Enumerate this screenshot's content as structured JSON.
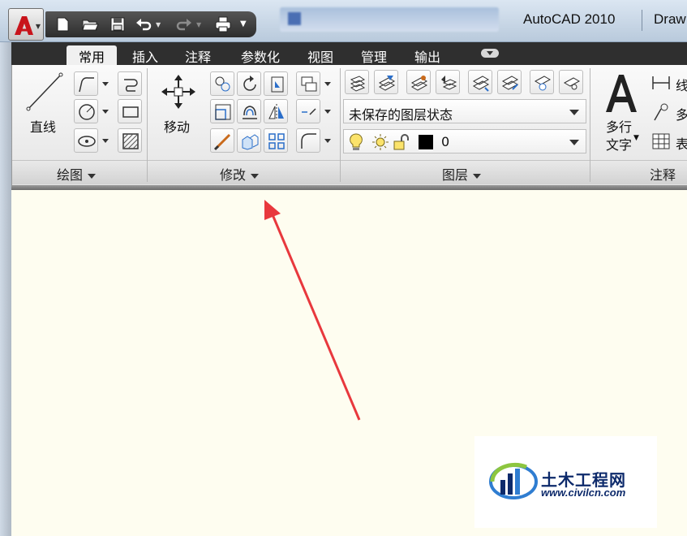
{
  "window": {
    "app_title": "AutoCAD 2010",
    "doc_title": "Draw"
  },
  "tabs": [
    {
      "label": "常用",
      "active": true
    },
    {
      "label": "插入",
      "active": false
    },
    {
      "label": "注释",
      "active": false
    },
    {
      "label": "参数化",
      "active": false
    },
    {
      "label": "视图",
      "active": false
    },
    {
      "label": "管理",
      "active": false
    },
    {
      "label": "输出",
      "active": false
    }
  ],
  "ribbon": {
    "draw": {
      "title": "绘图",
      "line_label": "直线"
    },
    "modify": {
      "title": "修改",
      "move_label": "移动"
    },
    "layers": {
      "title": "图层",
      "layer_state": "未保存的图层状态",
      "current_layer": "0"
    },
    "annotation": {
      "title": "注释",
      "mtext_label_1": "多行",
      "mtext_label_2": "文字",
      "line_item": "线",
      "multi_item": "多",
      "table_item": "表"
    }
  },
  "colors": {
    "canvas_bg": "#fefdf0",
    "annotation_arrow": "#e8383d",
    "tabbar_bg": "#2f2f2f",
    "layer_color_swatch": "#000000"
  },
  "watermark": {
    "name": "土木工程网",
    "url": "www.civilcn.com"
  }
}
